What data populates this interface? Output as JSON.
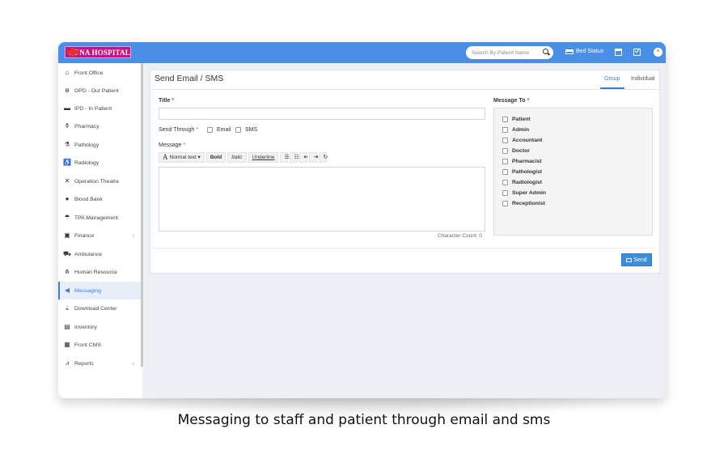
{
  "brand": {
    "name": "APNA HOSPITAL",
    "logo_color": "#c0168a"
  },
  "topbar": {
    "color": "#4a8fe7",
    "search_placeholder": "Search By Patient Name",
    "bed_status_label": "Bed Status"
  },
  "sidebar": {
    "items": [
      {
        "label": "Front Office",
        "icon": "building-icon"
      },
      {
        "label": "OPD - Out Patient",
        "icon": "stethoscope-icon"
      },
      {
        "label": "IPD - In Patient",
        "icon": "bed-icon"
      },
      {
        "label": "Pharmacy",
        "icon": "mortar-pestle-icon"
      },
      {
        "label": "Pathology",
        "icon": "flask-icon"
      },
      {
        "label": "Radiology",
        "icon": "xray-icon"
      },
      {
        "label": "Operation Theatre",
        "icon": "scissors-icon"
      },
      {
        "label": "Blood Bank",
        "icon": "drop-icon"
      },
      {
        "label": "TPA Management",
        "icon": "umbrella-icon"
      },
      {
        "label": "Finance",
        "icon": "money-icon",
        "chevron": "‹"
      },
      {
        "label": "Ambulance",
        "icon": "ambulance-icon"
      },
      {
        "label": "Human Resource",
        "icon": "sitemap-icon"
      },
      {
        "label": "Messaging",
        "icon": "bullhorn-icon",
        "active": true
      },
      {
        "label": "Download Center",
        "icon": "download-icon"
      },
      {
        "label": "Inventory",
        "icon": "inventory-icon"
      },
      {
        "label": "Front CMS",
        "icon": "cms-icon"
      },
      {
        "label": "Reports",
        "icon": "chart-icon",
        "chevron": "‹"
      }
    ]
  },
  "panel": {
    "title": "Send Email / SMS",
    "tabs": {
      "group": "Group",
      "individual": "Individual"
    },
    "title_label": "Title",
    "required_mark": "*",
    "send_through_label": "Send Through",
    "email_label": "Email",
    "sms_label": "SMS",
    "message_label": "Message",
    "toolbar": {
      "normal_text": "Normal text",
      "normal_glyph": "A",
      "bold": "Bold",
      "italic": "Italic",
      "underline": "Underline"
    },
    "char_count": "Character Count: 0",
    "message_to_label": "Message To",
    "recipients": [
      "Patient",
      "Admin",
      "Accountant",
      "Doctor",
      "Pharmacist",
      "Pathologist",
      "Radiologist",
      "Super Admin",
      "Receptionist"
    ],
    "send_label": "Send",
    "accent": "#3c8dda"
  },
  "caption": "Messaging to staff and patient through email and sms"
}
